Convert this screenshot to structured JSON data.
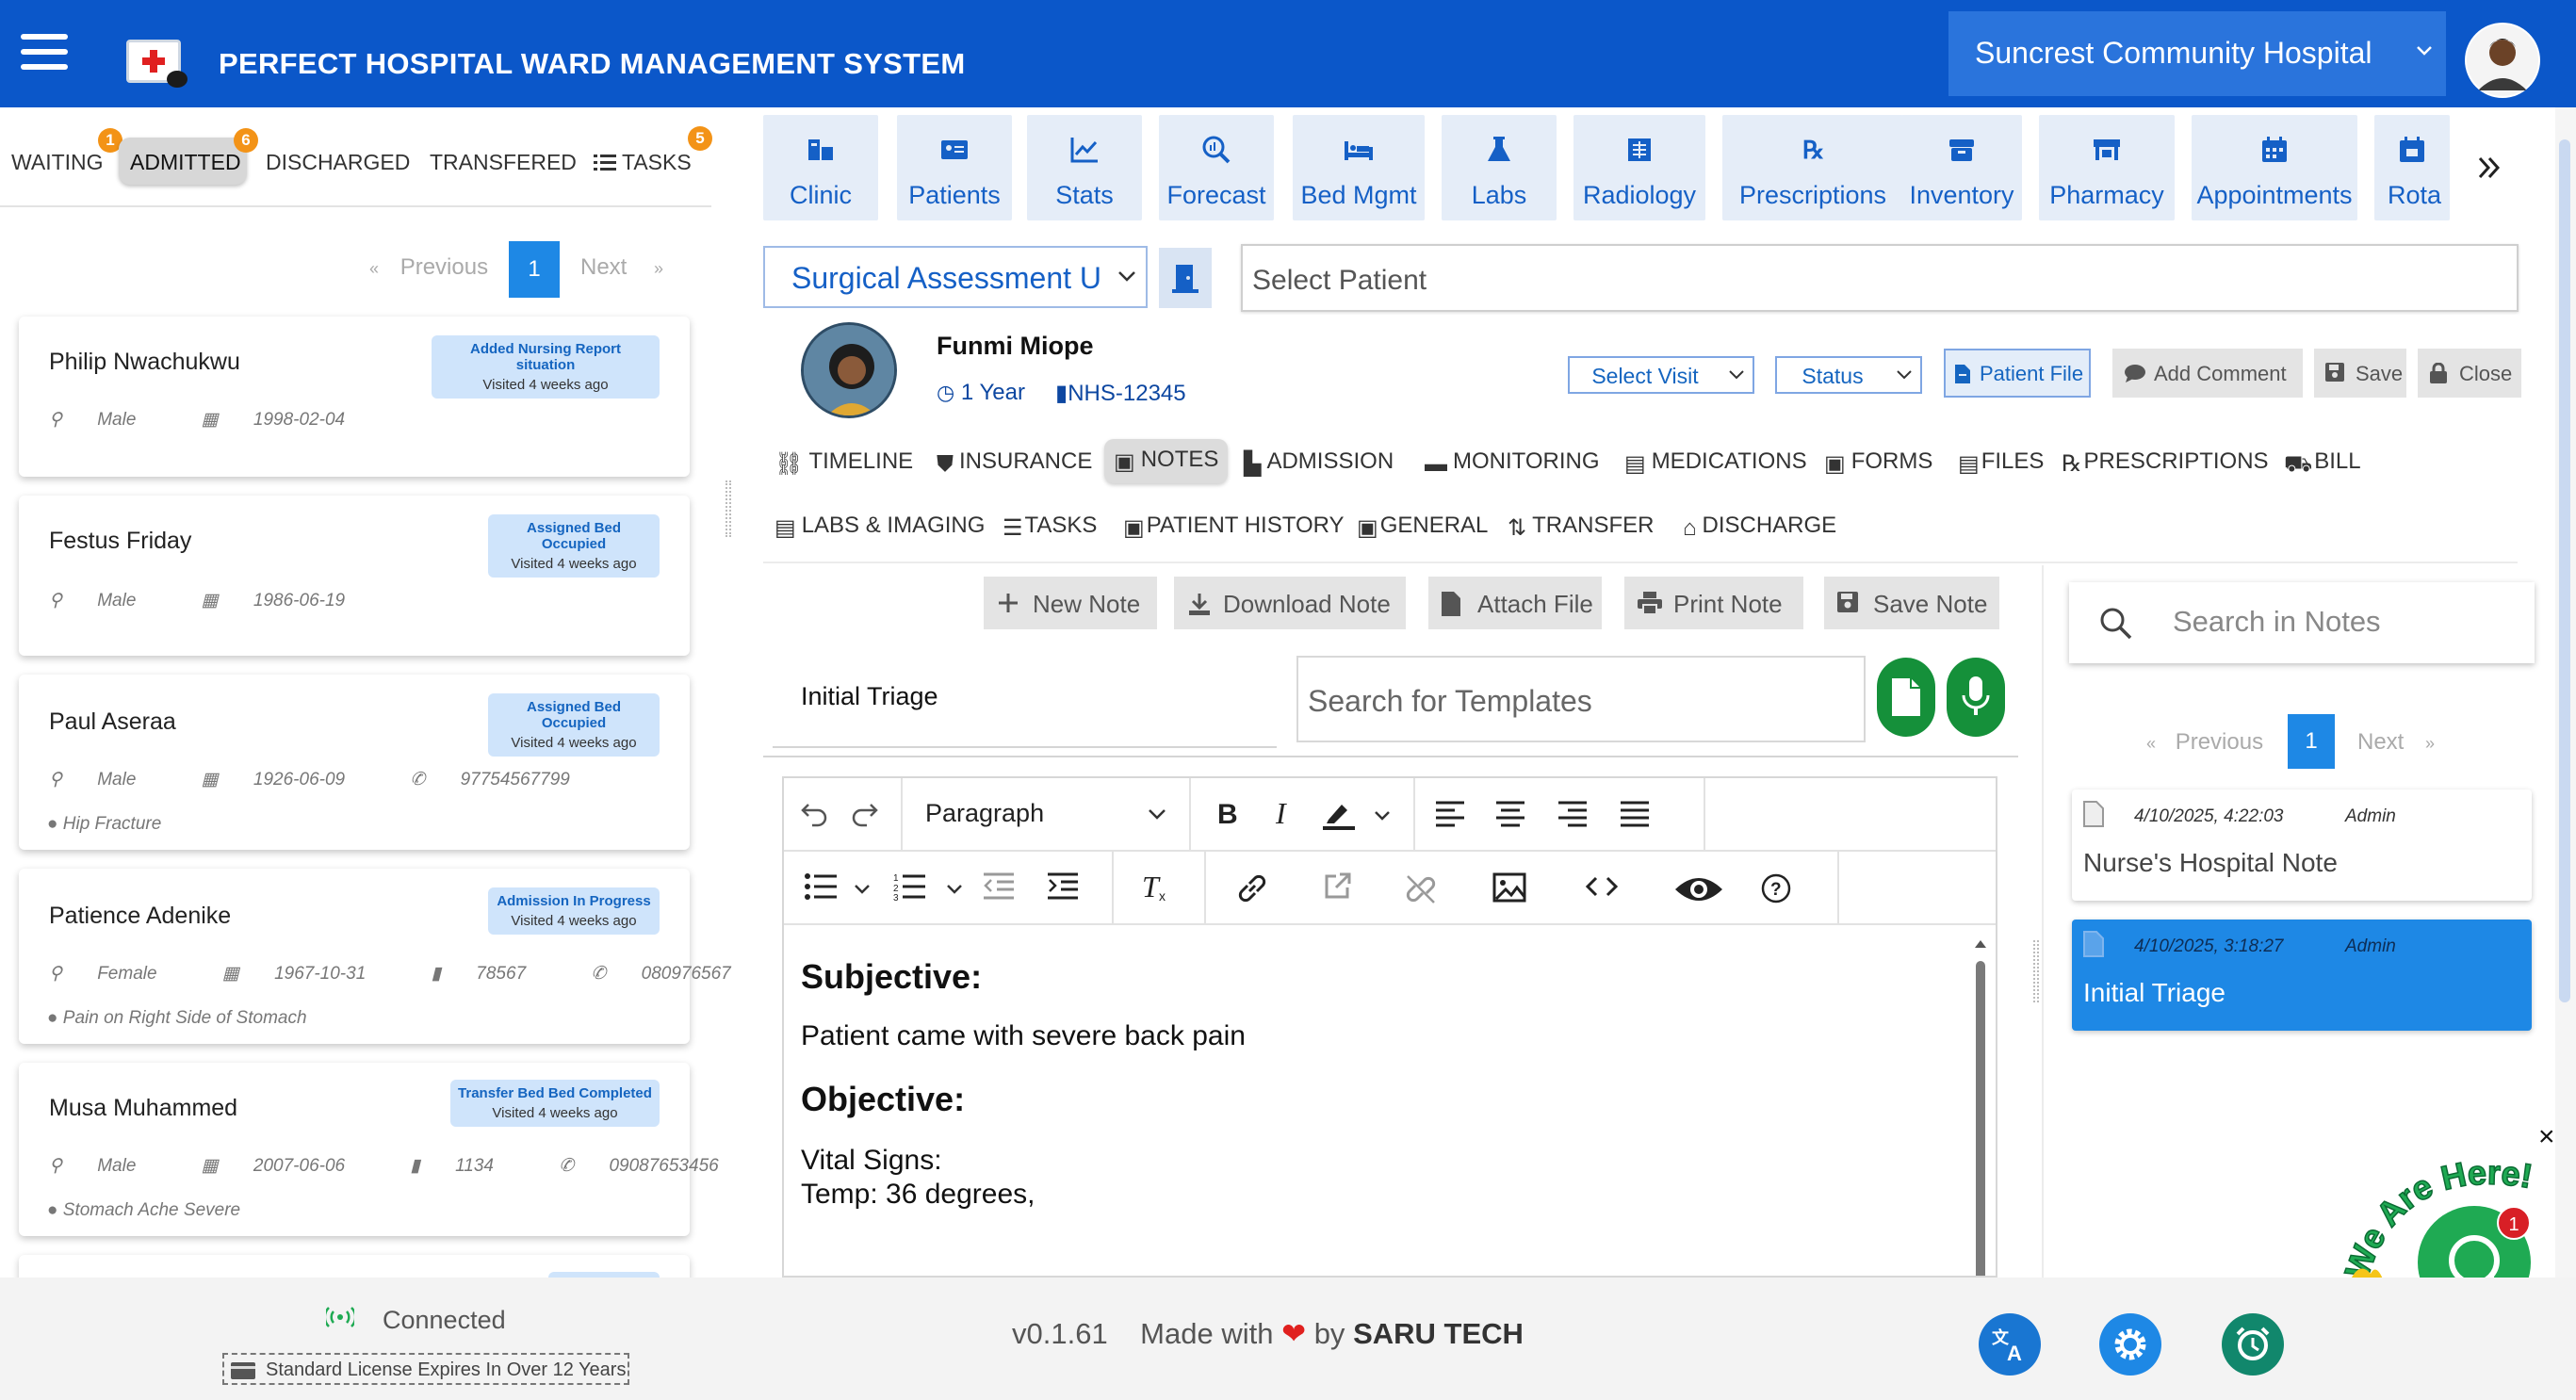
{
  "header": {
    "title": "PERFECT HOSPITAL WARD MANAGEMENT SYSTEM",
    "hospital": "Suncrest Community Hospital",
    "primary_color": "#0b57c9"
  },
  "left": {
    "tabs": [
      {
        "label": "WAITING",
        "badge": "1"
      },
      {
        "label": "ADMITTED",
        "badge": "6",
        "active": true
      },
      {
        "label": "DISCHARGED"
      },
      {
        "label": "TRANSFERED"
      },
      {
        "label": "TASKS",
        "badge": "5"
      }
    ],
    "pagination": {
      "previous": "Previous",
      "page": "1",
      "next": "Next",
      "prev_arrow": "«",
      "next_arrow": "»"
    },
    "patients": [
      {
        "name": "Philip Nwachukwu",
        "status": "Added Nursing Report situation",
        "visited": "Visited 4 weeks ago",
        "gender": "Male",
        "dob": "1998-02-04"
      },
      {
        "name": "Festus Friday",
        "status": "Assigned Bed Occupied",
        "visited": "Visited 4 weeks ago",
        "gender": "Male",
        "dob": "1986-06-19"
      },
      {
        "name": "Paul Aseraa",
        "status": "Assigned Bed Occupied",
        "visited": "Visited 4 weeks ago",
        "gender": "Male",
        "dob": "1926-06-09",
        "phone": "97754567799",
        "diagnosis": "Hip Fracture"
      },
      {
        "name": "Patience Adenike",
        "status": "Admission In Progress",
        "visited": "Visited 4 weeks ago",
        "gender": "Female",
        "dob": "1967-10-31",
        "id": "78567",
        "phone": "080976567",
        "diagnosis": "Pain on Right Side of Stomach"
      },
      {
        "name": "Musa Muhammed",
        "status": "Transfer Bed Bed Completed",
        "visited": "Visited 4 weeks ago",
        "gender": "Male",
        "dob": "2007-06-06",
        "id": "1134",
        "phone": "09087653456",
        "diagnosis": "Stomach Ache Severe"
      }
    ]
  },
  "modules": [
    "Clinic",
    "Patients",
    "Stats",
    "Forecast",
    "Bed Mgmt",
    "Labs",
    "Radiology",
    "Prescriptions",
    "Inventory",
    "Pharmacy",
    "Appointments",
    "Rota"
  ],
  "unit_select": "Surgical Assessment Unit",
  "patient_select_placeholder": "Select  Patient",
  "patient": {
    "name": "Funmi Miope",
    "age": "1 Year",
    "nhs": "NHS-12345"
  },
  "actions": {
    "select_visit": "Select Visit",
    "status": "Status",
    "patient_file": "Patient File",
    "add_comment": "Add Comment",
    "save": "Save",
    "close": "Close"
  },
  "subtabs_row1": [
    "TIMELINE",
    "INSURANCE",
    "NOTES",
    "ADMISSION",
    "MONITORING",
    "MEDICATIONS",
    "FORMS",
    "FILES",
    "PRESCRIPTIONS",
    "BILL"
  ],
  "subtabs_row2": [
    "LABS & IMAGING",
    "TASKS",
    "PATIENT HISTORY",
    "GENERAL",
    "TRANSFER",
    "DISCHARGE"
  ],
  "note_actions": {
    "new": "New Note",
    "download": "Download Note",
    "attach": "Attach File",
    "print": "Print Note",
    "save": "Save Note"
  },
  "note": {
    "title": "Initial Triage",
    "template_placeholder": "Search for Templates",
    "block_format": "Paragraph",
    "content": {
      "h1": "Subjective:",
      "p1": "Patient came with severe back pain",
      "h2": "Objective:",
      "p2": "Vital Signs:",
      "p3": "Temp: 36 degrees,"
    }
  },
  "notes_panel": {
    "search_placeholder": "Search in Notes",
    "pagination": {
      "previous": "Previous",
      "page": "1",
      "next": "Next",
      "prev_arrow": "«",
      "next_arrow": "»"
    },
    "items": [
      {
        "date": "4/10/2025, 4:22:03",
        "author": "Admin",
        "title": "Nurse's Hospital Note",
        "selected": false
      },
      {
        "date": "4/10/2025, 3:18:27",
        "author": "Admin",
        "title": "Initial Triage",
        "selected": true
      }
    ]
  },
  "chat": {
    "text": "We Are Here!",
    "badge": "1",
    "close": "×"
  },
  "footer": {
    "connection": "Connected",
    "license": "Standard License Expires In Over 12 Years",
    "version": "v0.1.61",
    "made_with": "Made with",
    "by": "by",
    "company": "SARU TECH"
  }
}
